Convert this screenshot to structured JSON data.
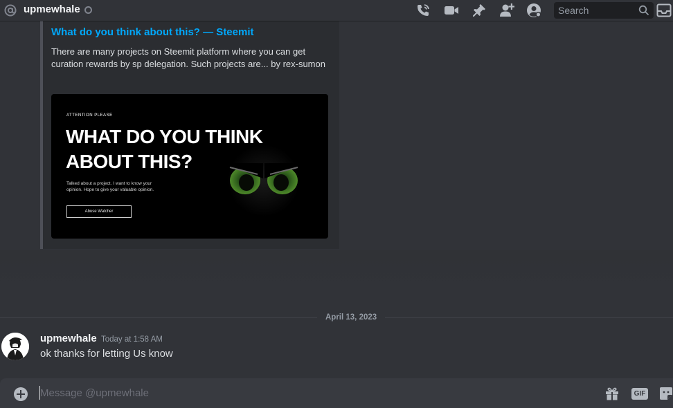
{
  "header": {
    "dm_name": "upmewhale",
    "search_placeholder": "Search",
    "icons": [
      "at-sign-icon",
      "status-offline-icon",
      "voice-call-icon",
      "video-call-icon",
      "pin-icon",
      "add-friend-icon",
      "user-profile-icon",
      "search-icon",
      "inbox-icon"
    ]
  },
  "embed": {
    "title": "What do you think about this? — Steemit",
    "description": "There are many projects on Steemit platform where you can get curation rewards by sp delegation. Such projects are... by rex-sumon",
    "image": {
      "kicker": "ATTENTION PLEASE",
      "headline_line1": "WHAT DO YOU THINK",
      "headline_line2": "ABOUT THIS?",
      "subtext_line1": "Talked about a project.  I want to know your",
      "subtext_line2": "opinion.  Hope to give your valuable opinion.",
      "button_label": "Abuse Watcher"
    }
  },
  "divider": {
    "date": "April 13, 2023"
  },
  "message": {
    "author": "upmewhale",
    "timestamp": "Today at 1:58 AM",
    "text": "ok thanks for letting Us know"
  },
  "composer": {
    "placeholder": "Message @upmewhale",
    "gif_label": "GIF",
    "icons": [
      "plus-icon",
      "gift-icon",
      "gif-icon",
      "sticker-icon"
    ]
  },
  "colors": {
    "background": "#313338",
    "embed_bg": "#2b2d31",
    "link": "#00a8fc",
    "composer_bg": "#383a40",
    "muted": "#949ba4"
  }
}
